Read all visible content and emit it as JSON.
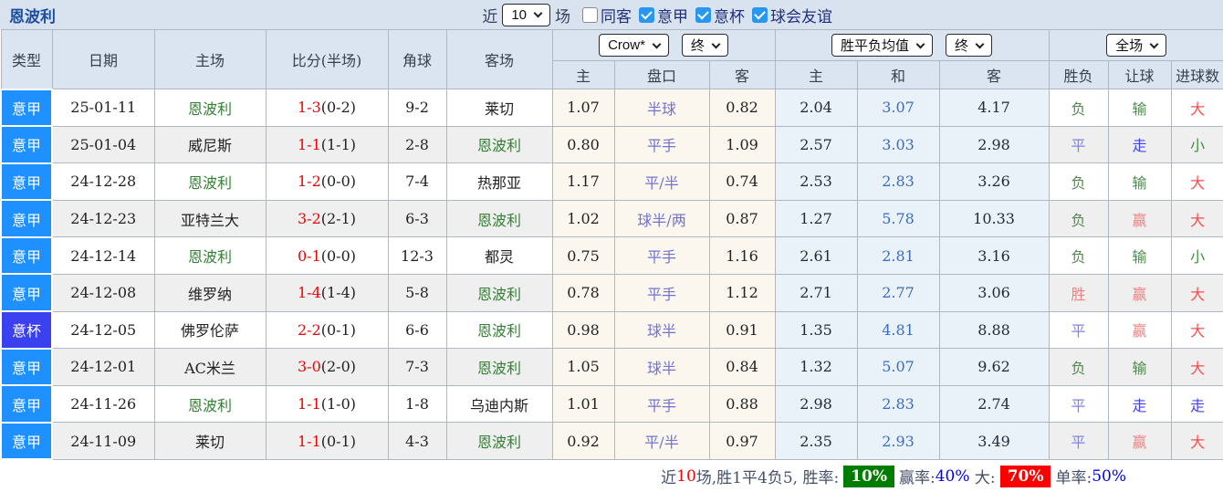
{
  "title": "恩波利",
  "topbar": {
    "recent_label": "近",
    "recent_value": "10",
    "matches_label": "场",
    "checkboxes": [
      {
        "label": "同客",
        "checked": false
      },
      {
        "label": "意甲",
        "checked": true
      },
      {
        "label": "意杯",
        "checked": true
      },
      {
        "label": "球会友谊",
        "checked": true
      }
    ]
  },
  "table": {
    "headers": [
      "类型",
      "日期",
      "主场",
      "比分(半场)",
      "角球",
      "客场"
    ],
    "selects": {
      "odds_source": "Crow*",
      "odds_time": "终",
      "avg_source": "胜平负均值",
      "avg_time": "终",
      "scope": "全场"
    },
    "subheaders": [
      "主",
      "盘口",
      "客",
      "主",
      "和",
      "客",
      "胜负",
      "让球",
      "进球数"
    ],
    "rows": [
      {
        "type": "意甲",
        "league": "seriea",
        "date": "25-01-11",
        "home": "恩波利",
        "home_is_team": true,
        "score": "1-3",
        "half": "(0-2)",
        "corners": "9-2",
        "away": "莱切",
        "away_is_team": false,
        "odds_home": "1.07",
        "handicap": "半球",
        "odds_away": "0.82",
        "avg_home": "2.04",
        "avg_draw": "3.07",
        "avg_away": "4.17",
        "result": "负",
        "result_cls": "lose",
        "hc_result": "输",
        "hc_cls": "lose",
        "goals": "大",
        "goals_cls": "big"
      },
      {
        "type": "意甲",
        "league": "seriea",
        "date": "25-01-04",
        "home": "威尼斯",
        "home_is_team": false,
        "score": "1-1",
        "half": "(1-1)",
        "corners": "2-8",
        "away": "恩波利",
        "away_is_team": true,
        "odds_home": "0.80",
        "handicap": "平手",
        "odds_away": "1.09",
        "avg_home": "2.57",
        "avg_draw": "3.03",
        "avg_away": "2.98",
        "result": "平",
        "result_cls": "draw",
        "hc_result": "走",
        "hc_cls": "go",
        "goals": "小",
        "goals_cls": "small"
      },
      {
        "type": "意甲",
        "league": "seriea",
        "date": "24-12-28",
        "home": "恩波利",
        "home_is_team": true,
        "score": "1-2",
        "half": "(0-0)",
        "corners": "7-4",
        "away": "热那亚",
        "away_is_team": false,
        "odds_home": "1.17",
        "handicap": "平/半",
        "odds_away": "0.74",
        "avg_home": "2.53",
        "avg_draw": "2.83",
        "avg_away": "3.26",
        "result": "负",
        "result_cls": "lose",
        "hc_result": "输",
        "hc_cls": "lose",
        "goals": "大",
        "goals_cls": "big"
      },
      {
        "type": "意甲",
        "league": "seriea",
        "date": "24-12-23",
        "home": "亚特兰大",
        "home_is_team": false,
        "score": "3-2",
        "half": "(2-1)",
        "corners": "6-3",
        "away": "恩波利",
        "away_is_team": true,
        "odds_home": "1.02",
        "handicap": "球半/两",
        "odds_away": "0.87",
        "avg_home": "1.27",
        "avg_draw": "5.78",
        "avg_away": "10.33",
        "result": "负",
        "result_cls": "lose",
        "hc_result": "赢",
        "hc_cls": "win",
        "goals": "大",
        "goals_cls": "big"
      },
      {
        "type": "意甲",
        "league": "seriea",
        "date": "24-12-14",
        "home": "恩波利",
        "home_is_team": true,
        "score": "0-1",
        "half": "(0-0)",
        "corners": "12-3",
        "away": "都灵",
        "away_is_team": false,
        "odds_home": "0.75",
        "handicap": "平手",
        "odds_away": "1.16",
        "avg_home": "2.61",
        "avg_draw": "2.81",
        "avg_away": "3.16",
        "result": "负",
        "result_cls": "lose",
        "hc_result": "输",
        "hc_cls": "lose",
        "goals": "小",
        "goals_cls": "small"
      },
      {
        "type": "意甲",
        "league": "seriea",
        "date": "24-12-08",
        "home": "维罗纳",
        "home_is_team": false,
        "score": "1-4",
        "half": "(1-4)",
        "corners": "5-8",
        "away": "恩波利",
        "away_is_team": true,
        "odds_home": "0.78",
        "handicap": "平手",
        "odds_away": "1.12",
        "avg_home": "2.71",
        "avg_draw": "2.77",
        "avg_away": "3.06",
        "result": "胜",
        "result_cls": "win",
        "hc_result": "赢",
        "hc_cls": "win",
        "goals": "大",
        "goals_cls": "big"
      },
      {
        "type": "意杯",
        "league": "cup",
        "date": "24-12-05",
        "home": "佛罗伦萨",
        "home_is_team": false,
        "score": "2-2",
        "half": "(0-1)",
        "corners": "6-6",
        "away": "恩波利",
        "away_is_team": true,
        "odds_home": "0.98",
        "handicap": "球半",
        "odds_away": "0.91",
        "avg_home": "1.35",
        "avg_draw": "4.81",
        "avg_away": "8.88",
        "result": "平",
        "result_cls": "draw",
        "hc_result": "赢",
        "hc_cls": "win",
        "goals": "大",
        "goals_cls": "big"
      },
      {
        "type": "意甲",
        "league": "seriea",
        "date": "24-12-01",
        "home": "AC米兰",
        "home_is_team": false,
        "score": "3-0",
        "half": "(2-0)",
        "corners": "7-3",
        "away": "恩波利",
        "away_is_team": true,
        "odds_home": "1.05",
        "handicap": "球半",
        "odds_away": "0.84",
        "avg_home": "1.32",
        "avg_draw": "5.07",
        "avg_away": "9.62",
        "result": "负",
        "result_cls": "lose",
        "hc_result": "输",
        "hc_cls": "lose",
        "goals": "大",
        "goals_cls": "big"
      },
      {
        "type": "意甲",
        "league": "seriea",
        "date": "24-11-26",
        "home": "恩波利",
        "home_is_team": true,
        "score": "1-1",
        "half": "(1-0)",
        "corners": "1-8",
        "away": "乌迪内斯",
        "away_is_team": false,
        "odds_home": "1.01",
        "handicap": "平手",
        "odds_away": "0.88",
        "avg_home": "2.98",
        "avg_draw": "2.83",
        "avg_away": "2.74",
        "result": "平",
        "result_cls": "draw",
        "hc_result": "走",
        "hc_cls": "go",
        "goals": "走",
        "goals_cls": "go"
      },
      {
        "type": "意甲",
        "league": "seriea",
        "date": "24-11-09",
        "home": "莱切",
        "home_is_team": false,
        "score": "1-1",
        "half": "(0-1)",
        "corners": "4-3",
        "away": "恩波利",
        "away_is_team": true,
        "odds_home": "0.92",
        "handicap": "平/半",
        "odds_away": "0.97",
        "avg_home": "2.35",
        "avg_draw": "2.93",
        "avg_away": "3.49",
        "result": "平",
        "result_cls": "draw",
        "hc_result": "赢",
        "hc_cls": "win",
        "goals": "大",
        "goals_cls": "big"
      }
    ]
  },
  "summary": {
    "segments": [
      {
        "text": "近",
        "kind": "plain"
      },
      {
        "text": "10",
        "kind": "red"
      },
      {
        "text": "场,胜1平4负5, 胜率:",
        "kind": "plain"
      },
      {
        "text": "10%",
        "kind": "greenbox"
      },
      {
        "text": "赢率:",
        "kind": "plain"
      },
      {
        "text": "40%",
        "kind": "blue"
      },
      {
        "text": " 大:",
        "kind": "plain"
      },
      {
        "text": "70%",
        "kind": "redbox"
      },
      {
        "text": "单率:",
        "kind": "plain"
      },
      {
        "text": "50%",
        "kind": "blue"
      }
    ]
  },
  "colors": {
    "seriea": "#1e90ff",
    "cup": "#3b41ee",
    "team_green": "#338033",
    "score_red": "#f40000",
    "summary_green": "#007d00",
    "summary_red": "#fb0000",
    "summary_blue": "#0000ee"
  }
}
